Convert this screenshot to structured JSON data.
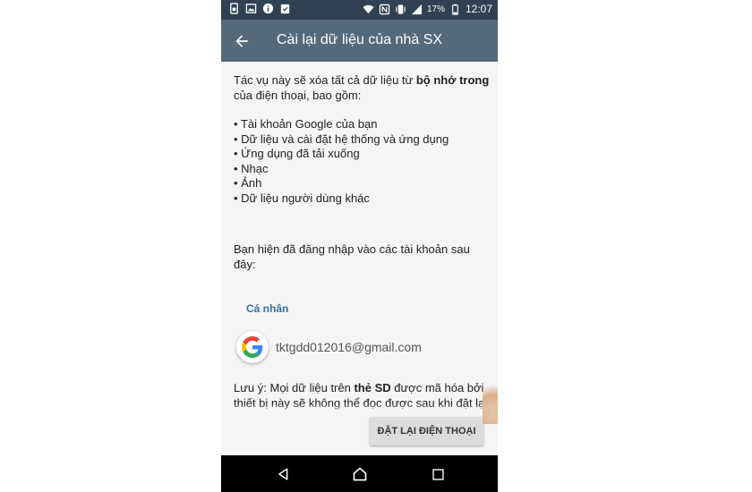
{
  "status_bar": {
    "battery_percent": "17%",
    "time": "12:07",
    "icons_left": [
      "sim-icon",
      "image-icon",
      "info-icon",
      "clipboard-check-icon"
    ],
    "icons_right": [
      "wifi-icon",
      "nfc-icon",
      "vibrate-icon",
      "signal-icon",
      "battery-icon"
    ]
  },
  "app_bar": {
    "title": "Cài lại dữ liệu của nhà SX",
    "back_icon": "arrow-back-icon"
  },
  "content": {
    "intro_pre": "Tác vụ này sẽ xóa tất cả dữ liệu từ ",
    "intro_bold": "bộ nhớ trong",
    "intro_post": " của điện thoại, bao gồm:",
    "items": [
      "Tài khoản Google của bạn",
      "Dữ liệu và cài đặt hệ thống và ứng dụng",
      "Ứng dụng đã tải xuống",
      "Nhạc",
      "Ảnh",
      "Dữ liệu người dùng khác"
    ],
    "signed_in_text": "Bạn hiện đã đăng nhập vào các tài khoản sau đây:",
    "section_header": "Cá nhân",
    "account_email": "tktgdd012016@gmail.com",
    "note_pre": "Lưu ý: Mọi dữ liệu trên ",
    "note_bold": "thẻ SD",
    "note_post": " được mã hóa bởi thiết bị này sẽ không thể đọc được sau khi đặt lại dữ liệu về cài đặt gốc."
  },
  "reset_button": {
    "label": "ĐẶT LẠI ĐIỆN THOẠI"
  },
  "nav_bar": {
    "back_icon": "nav-back-icon",
    "home_icon": "nav-home-icon",
    "recents_icon": "nav-recents-icon"
  },
  "colors": {
    "status_bar": "#2f4152",
    "app_bar": "#546a7b",
    "background": "#f5f5f5",
    "section_header": "#3a6e9e",
    "button": "#dcdcdc"
  }
}
